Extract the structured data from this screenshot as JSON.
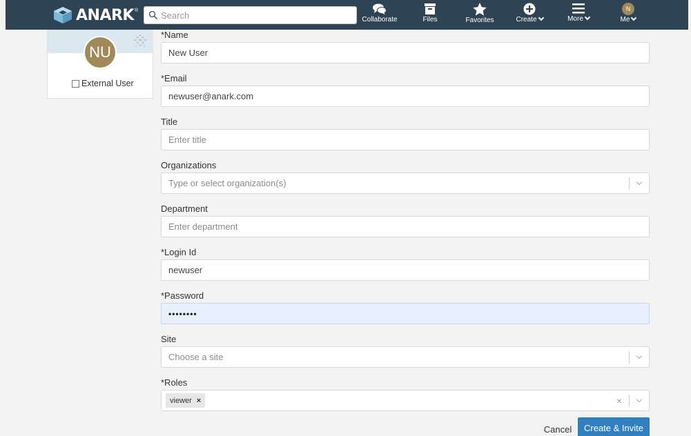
{
  "app": {
    "logo_text": "ANARK",
    "logo_mark": "®"
  },
  "search": {
    "placeholder": "Search",
    "value": ""
  },
  "nav": {
    "collaborate": "Collaborate",
    "files": "Files",
    "favorites": "Favorites",
    "create": "Create",
    "more": "More",
    "me": "Me",
    "me_initial": "N"
  },
  "profile": {
    "initials": "NU",
    "external_user_label": "External User",
    "external_user_checked": false
  },
  "form": {
    "name": {
      "label": "*Name",
      "value": "New User"
    },
    "email": {
      "label": "*Email",
      "value": "newuser@anark.com"
    },
    "title": {
      "label": "Title",
      "placeholder": "Enter title"
    },
    "organizations": {
      "label": "Organizations",
      "placeholder": "Type or select organization(s)"
    },
    "department": {
      "label": "Department",
      "placeholder": "Enter department"
    },
    "login_id": {
      "label": "*Login Id",
      "value": "newuser"
    },
    "password": {
      "label": "*Password",
      "value": "••••••••"
    },
    "site": {
      "label": "Site",
      "placeholder": "Choose a site"
    },
    "roles": {
      "label": "*Roles",
      "tags": [
        "viewer"
      ],
      "tag_remove": "×",
      "clear": "×"
    }
  },
  "actions": {
    "cancel": "Cancel",
    "create_invite": "Create & Invite"
  },
  "colors": {
    "topbar": "#2e4454",
    "accent": "#2f7fc1",
    "avatar": "#a08a5a",
    "password_bg": "#e8f0fe"
  }
}
